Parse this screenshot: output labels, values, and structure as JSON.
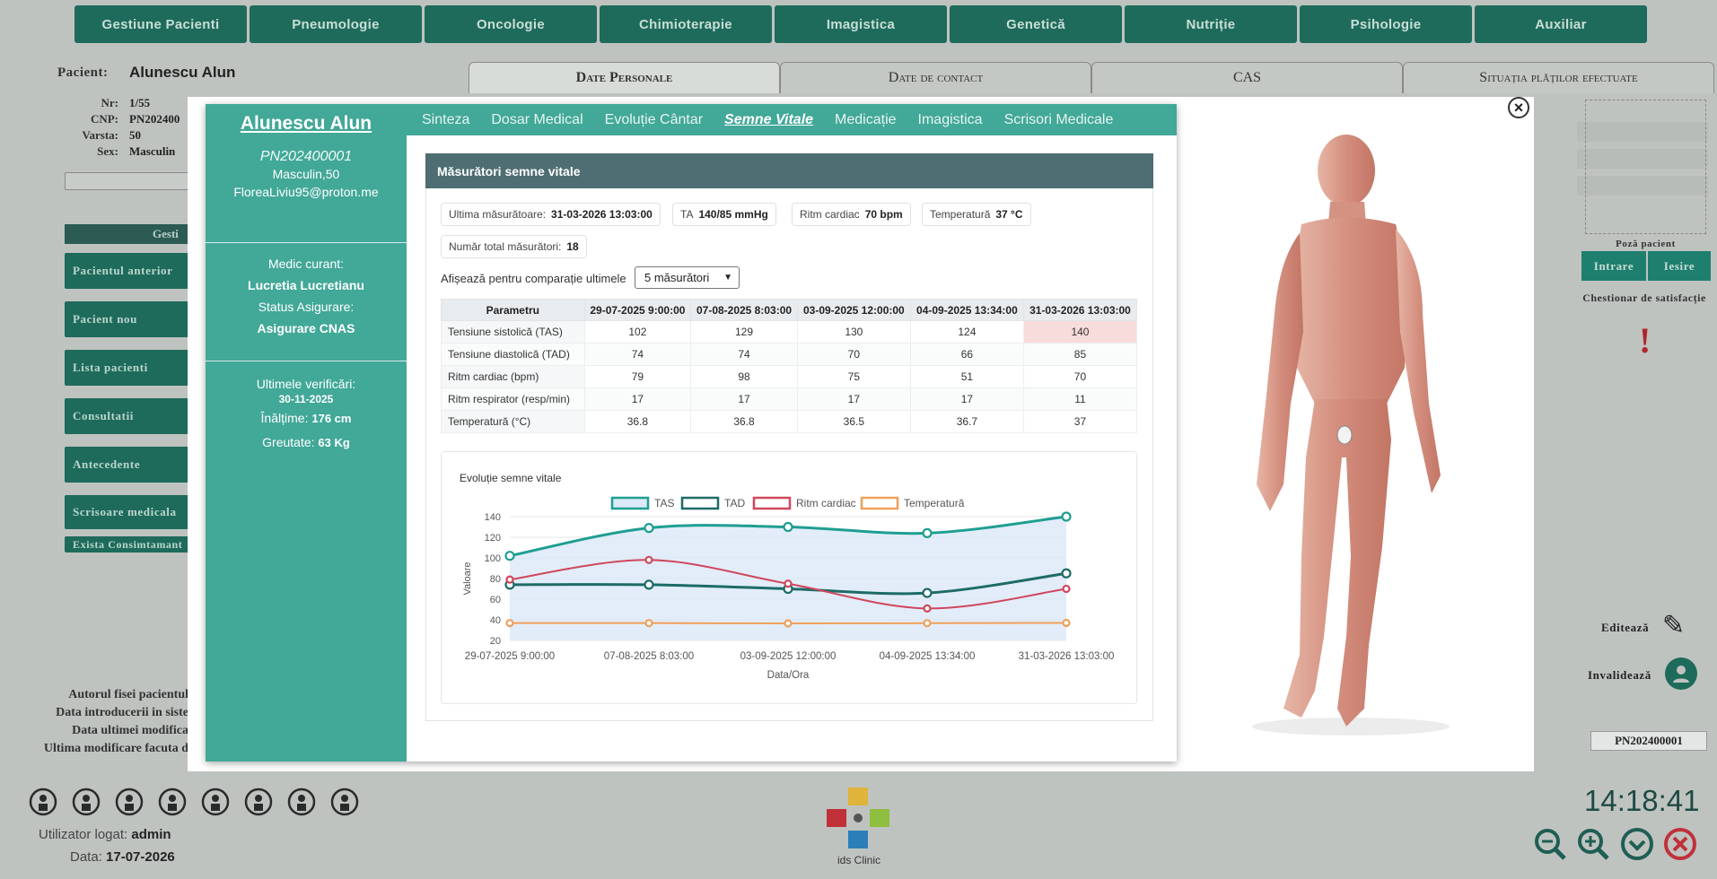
{
  "topnav": [
    "Gestiune Pacienti",
    "Pneumologie",
    "Oncologie",
    "Chimioterapie",
    "Imagistica",
    "Genetică",
    "Nutriție",
    "Psihologie",
    "Auxiliar"
  ],
  "background": {
    "pacient_label": "Pacient:",
    "pacient_name": "Alunescu Alun",
    "fields": [
      {
        "label": "Nr:",
        "value": "1/55"
      },
      {
        "label": "CNP:",
        "value": "PN202400"
      },
      {
        "label": "Varsta:",
        "value": "50"
      },
      {
        "label": "Sex:",
        "value": "Masculin"
      }
    ],
    "gest_label": "Gesti",
    "buttons": [
      "Pacientul anterior",
      "Pacient nou",
      "Lista pacienti",
      "Consultatii",
      "Antecedente",
      "Scrisoare medicala",
      "Exista Consimtamant"
    ],
    "footer_lines": [
      "Autorul fisei pacientul",
      "Data introducerii in siste",
      "Data ultimei modifica",
      "Ultima modificare facuta d"
    ],
    "tabs": [
      "Date Personale",
      "Date de contact",
      "CAS",
      "Situația plăților efectuate"
    ],
    "right": {
      "poza": "Poză pacient",
      "intrare": "Intrare",
      "iesire": "Iesire",
      "chestionar": "Chestionar de satisfacție",
      "editeaza": "Editează",
      "invalideaza": "Invalidează",
      "cnp_box": "PN202400001"
    }
  },
  "modal": {
    "close": "×",
    "patient": {
      "name": "Alunescu Alun",
      "id": "PN202400001",
      "sex_age": "Masculin,50",
      "email": "FloreaLiviu95@proton.me",
      "medic_label": "Medic curant:",
      "medic": "Lucretia Lucretianu",
      "status_label": "Status Asigurare:",
      "status": "Asigurare CNAS",
      "verif_label": "Ultimele verificări:",
      "verif_date": "30-11-2025",
      "height_label": "Înălțime:",
      "height": "176 cm",
      "weight_label": "Greutate:",
      "weight": "63 Kg"
    },
    "tabs": [
      "Sinteza",
      "Dosar Medical",
      "Evoluție Cântar",
      "Semne Vitale",
      "Medicație",
      "Imagistica",
      "Scrisori Medicale"
    ],
    "active_tab": "Semne Vitale",
    "panel_title": "Măsurători semne vitale",
    "badges": [
      {
        "label": "Ultima măsurătoare:",
        "value": "31-03-2026 13:03:00"
      },
      {
        "label": "TA",
        "value": "140/85 mmHg"
      },
      {
        "label": "Ritm cardiac",
        "value": "70 bpm"
      },
      {
        "label": "Temperatură",
        "value": "37 °C"
      }
    ],
    "total_label": "Număr total măsurători:",
    "total_value": "18",
    "compare_label": "Afișează pentru comparație ultimele",
    "compare_select": "5 măsurători",
    "table": {
      "headers": [
        "Parametru",
        "29-07-2025 9:00:00",
        "07-08-2025 8:03:00",
        "03-09-2025 12:00:00",
        "04-09-2025 13:34:00",
        "31-03-2026 13:03:00"
      ],
      "rows": [
        [
          "Tensiune sistolică (TAS)",
          "102",
          "129",
          "130",
          "124",
          "140"
        ],
        [
          "Tensiune diastolică (TAD)",
          "74",
          "74",
          "70",
          "66",
          "85"
        ],
        [
          "Ritm cardiac (bpm)",
          "79",
          "98",
          "75",
          "51",
          "70"
        ],
        [
          "Ritm respirator (resp/min)",
          "17",
          "17",
          "17",
          "17",
          "11"
        ],
        [
          "Temperatură (°C)",
          "36.8",
          "36.8",
          "36.5",
          "36.7",
          "37"
        ]
      ]
    }
  },
  "chart_data": {
    "type": "line",
    "title": "Evoluție semne vitale",
    "xlabel": "Data/Ora",
    "ylabel": "Valoare",
    "categories": [
      "29-07-2025 9:00:00",
      "07-08-2025 8:03:00",
      "03-09-2025 12:00:00",
      "04-09-2025 13:34:00",
      "31-03-2026 13:03:00"
    ],
    "ylim": [
      20,
      140
    ],
    "yticks": [
      20,
      40,
      60,
      80,
      100,
      120,
      140
    ],
    "legend_position": "top",
    "grid": true,
    "series": [
      {
        "name": "TAS",
        "values": [
          102,
          129,
          130,
          124,
          140
        ],
        "color": "#1e9e92",
        "fill": "#dbe9f8"
      },
      {
        "name": "TAD",
        "values": [
          74,
          74,
          70,
          66,
          85
        ],
        "color": "#1d6b66"
      },
      {
        "name": "Ritm cardiac",
        "values": [
          79,
          98,
          75,
          51,
          70
        ],
        "color": "#d0475c"
      },
      {
        "name": "Temperatură",
        "values": [
          36.8,
          36.8,
          36.5,
          36.7,
          37
        ],
        "color": "#f0a05a"
      }
    ]
  },
  "bottom": {
    "user_label": "Utilizator logat:",
    "user": "admin",
    "date_label": "Data:",
    "date": "17-07-2026",
    "logo_text": "ids Clinic",
    "clock": "14:18:41"
  }
}
